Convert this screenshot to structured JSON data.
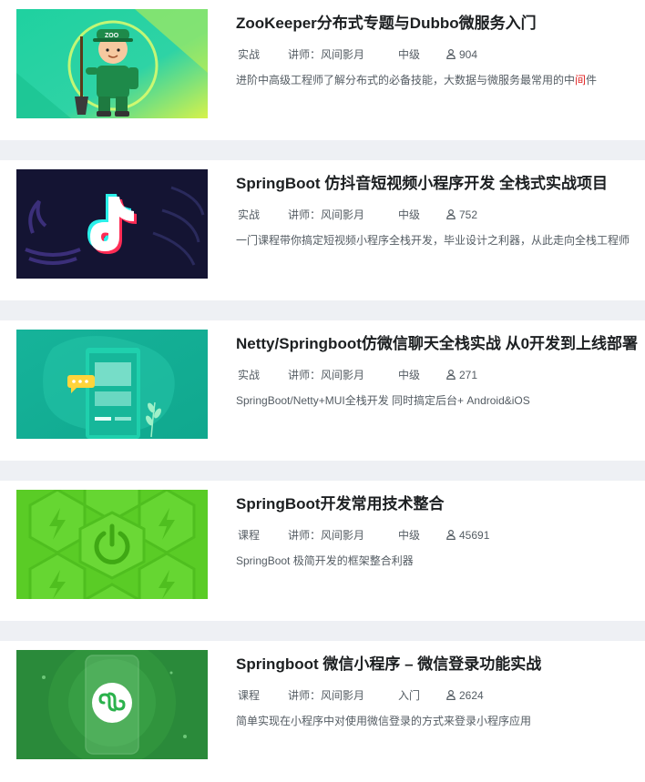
{
  "courses": [
    {
      "title": "ZooKeeper分布式专题与Dubbo微服务入门",
      "type": "实战",
      "teacher_label": "讲师：",
      "teacher": "风间影月",
      "level": "中级",
      "students": "904",
      "desc_before": "进阶中高级工程师了解分布式的必备技能，大数据与微服务最常用的中",
      "desc_highlight": "间",
      "desc_after": "件",
      "thumb_icon": "zookeeper-character-icon",
      "thumb_text": "ZOO"
    },
    {
      "title": "SpringBoot 仿抖音短视频小程序开发 全栈式实战项目",
      "type": "实战",
      "teacher_label": "讲师：",
      "teacher": "风间影月",
      "level": "中级",
      "students": "752",
      "desc": "一门课程带你搞定短视频小程序全栈开发，毕业设计之利器，从此走向全栈工程师",
      "thumb_icon": "tiktok-logo-icon"
    },
    {
      "title": "Netty/Springboot仿微信聊天全栈实战 从0开发到上线部署",
      "type": "实战",
      "teacher_label": "讲师：",
      "teacher": "风间影月",
      "level": "中级",
      "students": "271",
      "desc": "SpringBoot/Netty+MUI全栈开发 同时搞定后台+ Android&iOS",
      "thumb_icon": "chat-phone-icon"
    },
    {
      "title": "SpringBoot开发常用技术整合",
      "type": "课程",
      "teacher_label": "讲师：",
      "teacher": "风间影月",
      "level": "中级",
      "students": "45691",
      "desc": "SpringBoot 极简开发的框架整合利器",
      "thumb_icon": "power-hexagon-icon"
    },
    {
      "title": "Springboot 微信小程序 – 微信登录功能实战",
      "type": "课程",
      "teacher_label": "讲师：",
      "teacher": "风间影月",
      "level": "入门",
      "students": "2624",
      "desc": "简单实现在小程序中对使用微信登录的方式来登录小程序应用",
      "thumb_icon": "mini-program-icon"
    }
  ],
  "colors": {
    "page_bg": "#eef0f4",
    "title": "#1c1f21",
    "meta": "#545c63",
    "highlight": "#e02020"
  }
}
